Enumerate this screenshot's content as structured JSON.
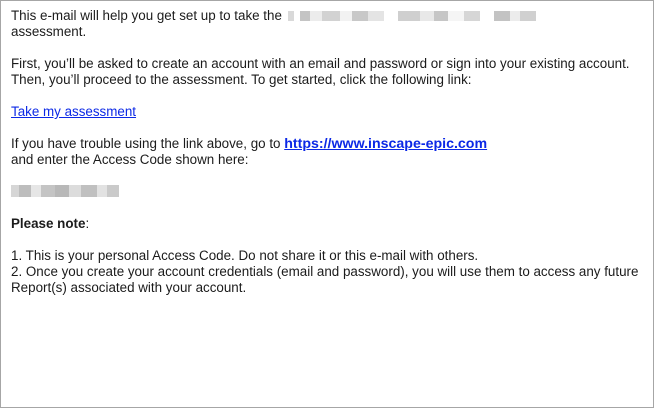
{
  "email": {
    "intro_prefix": "This e-mail will help you get set up to take the",
    "intro_suffix": "assessment.",
    "instructions": "First, you’ll be asked to create an account with an email and password or sign into your existing account. Then, you’ll proceed to the assessment. To get started, click the following link:",
    "assessment_link": "Take my assessment",
    "trouble_prefix": "If you have trouble using the link above, go to",
    "site_link": "https://www.inscape-epic.com",
    "trouble_suffix": "and enter the Access Code shown here:",
    "note_heading": "Please note",
    "note_colon": ":",
    "note_1": "1. This is your personal Access Code. Do not share it or this e-mail with others.",
    "note_2": "2. Once you create your account credentials (email and password), you will use them to access any future Report(s) associated with your account."
  }
}
